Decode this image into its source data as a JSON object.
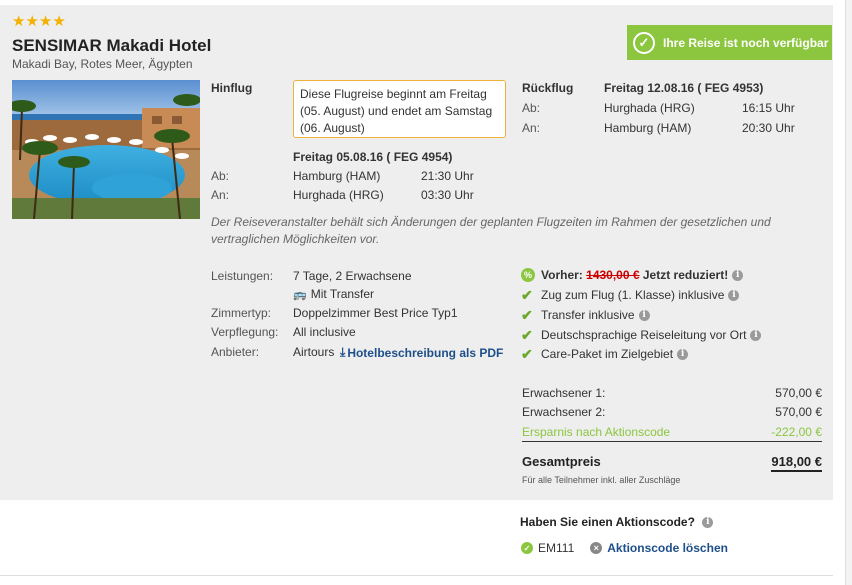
{
  "hotel": {
    "stars": "★★★★",
    "name": "SENSIMAR Makadi Hotel",
    "location": "Makadi Bay, Rotes Meer, Ägypten"
  },
  "availability": {
    "label": "Ihre Reise ist noch verfügbar",
    "color": "#8cc63f"
  },
  "outbound": {
    "title": "Hinflug",
    "notice": "Diese Flugreise beginnt am Freitag (05. August) und endet am Samstag (06. August)",
    "flight": "Freitag 05.08.16 ( FEG 4954)",
    "dep_label": "Ab:",
    "dep_airport": "Hamburg (HAM)",
    "dep_time": "21:30 Uhr",
    "arr_label": "An:",
    "arr_airport": "Hurghada (HRG)",
    "arr_time": "03:30 Uhr"
  },
  "return": {
    "title": "Rückflug",
    "flight": "Freitag 12.08.16 ( FEG 4953)",
    "dep_label": "Ab:",
    "dep_airport": "Hurghada (HRG)",
    "dep_time": "16:15 Uhr",
    "arr_label": "An:",
    "arr_airport": "Hamburg (HAM)",
    "arr_time": "20:30 Uhr"
  },
  "disclaimer": "Der Reiseveranstalter behält sich Änderungen der geplanten Flugzeiten im Rahmen der gesetzlichen und vertraglichen Möglichkeiten vor.",
  "details": {
    "services_label": "Leistungen:",
    "services_value": "7 Tage, 2 Erwachsene",
    "transfer": "Mit Transfer",
    "room_label": "Zimmertyp:",
    "room_value": "Doppelzimmer Best Price Typ1",
    "board_label": "Verpflegung:",
    "board_value": "All inclusive",
    "provider_label": "Anbieter:",
    "provider_value": "Airtours",
    "pdf_link": "Hotelbeschreibung als PDF"
  },
  "perks": {
    "before_label": "Vorher:",
    "before_price": "1430,00 €",
    "before_suffix": "Jetzt reduziert!",
    "item1": "Zug zum Flug (1. Klasse) inklusive",
    "item2": "Transfer inklusive",
    "item3": "Deutschsprachige Reiseleitung vor Ort",
    "item4": "Care-Paket im Zielgebiet"
  },
  "pricing": {
    "adult1_label": "Erwachsener 1:",
    "adult1_value": "570,00 €",
    "adult2_label": "Erwachsener 2:",
    "adult2_value": "570,00 €",
    "savings_label": "Ersparnis nach Aktionscode",
    "savings_value": "-222,00 €",
    "total_label": "Gesamtpreis",
    "total_value": "918,00 €",
    "note": "Für alle Teilnehmer inkl. aller Zuschläge"
  },
  "promo": {
    "question": "Haben Sie einen Aktionscode?",
    "code": "EM111",
    "delete": "Aktionscode löschen"
  }
}
